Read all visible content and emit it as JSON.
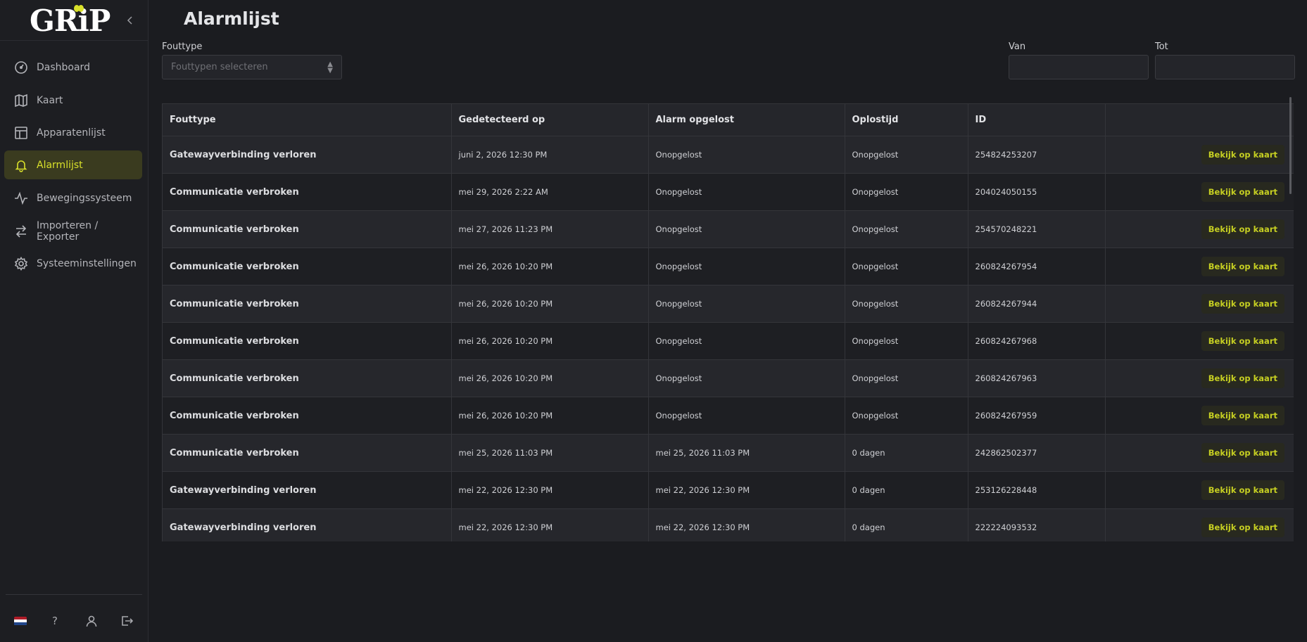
{
  "app": {
    "logo_text": "GRiP",
    "accent": "#d8e02a"
  },
  "sidebar": {
    "items": [
      {
        "label": "Dashboard",
        "icon": "gauge-icon"
      },
      {
        "label": "Kaart",
        "icon": "map-icon"
      },
      {
        "label": "Apparatenlijst",
        "icon": "table-icon"
      },
      {
        "label": "Alarmlijst",
        "icon": "bell-icon",
        "active": true
      },
      {
        "label": "Bewegingssysteem",
        "icon": "activity-icon"
      },
      {
        "label": "Importeren / Exporter",
        "icon": "swap-arrows-icon"
      },
      {
        "label": "Systeeminstellingen",
        "icon": "gear-icon"
      }
    ],
    "bottom": {
      "help_label": "?"
    }
  },
  "page": {
    "title": "Alarmlijst"
  },
  "filters": {
    "type_label": "Fouttype",
    "type_placeholder": "Fouttypen selecteren",
    "from_label": "Van",
    "to_label": "Tot"
  },
  "table": {
    "headers": [
      "Fouttype",
      "Gedetecteerd op",
      "Alarm opgelost",
      "Oplostijd",
      "ID",
      ""
    ],
    "action_label": "Bekijk op kaart",
    "rows": [
      [
        "Gatewayverbinding verloren",
        "juni 2, 2026 12:30 PM",
        "Onopgelost",
        "Onopgelost",
        "254824253207"
      ],
      [
        "Communicatie verbroken",
        "mei 29, 2026 2:22 AM",
        "Onopgelost",
        "Onopgelost",
        "204024050155"
      ],
      [
        "Communicatie verbroken",
        "mei 27, 2026 11:23 PM",
        "Onopgelost",
        "Onopgelost",
        "254570248221"
      ],
      [
        "Communicatie verbroken",
        "mei 26, 2026 10:20 PM",
        "Onopgelost",
        "Onopgelost",
        "260824267954"
      ],
      [
        "Communicatie verbroken",
        "mei 26, 2026 10:20 PM",
        "Onopgelost",
        "Onopgelost",
        "260824267944"
      ],
      [
        "Communicatie verbroken",
        "mei 26, 2026 10:20 PM",
        "Onopgelost",
        "Onopgelost",
        "260824267968"
      ],
      [
        "Communicatie verbroken",
        "mei 26, 2026 10:20 PM",
        "Onopgelost",
        "Onopgelost",
        "260824267963"
      ],
      [
        "Communicatie verbroken",
        "mei 26, 2026 10:20 PM",
        "Onopgelost",
        "Onopgelost",
        "260824267959"
      ],
      [
        "Communicatie verbroken",
        "mei 25, 2026 11:03 PM",
        "mei 25, 2026 11:03 PM",
        "0 dagen",
        "242862502377"
      ],
      [
        "Gatewayverbinding verloren",
        "mei 22, 2026 12:30 PM",
        "mei 22, 2026 12:30 PM",
        "0 dagen",
        "253126228448"
      ],
      [
        "Gatewayverbinding verloren",
        "mei 22, 2026 12:30 PM",
        "mei 22, 2026 12:30 PM",
        "0 dagen",
        "222224093532"
      ]
    ]
  }
}
